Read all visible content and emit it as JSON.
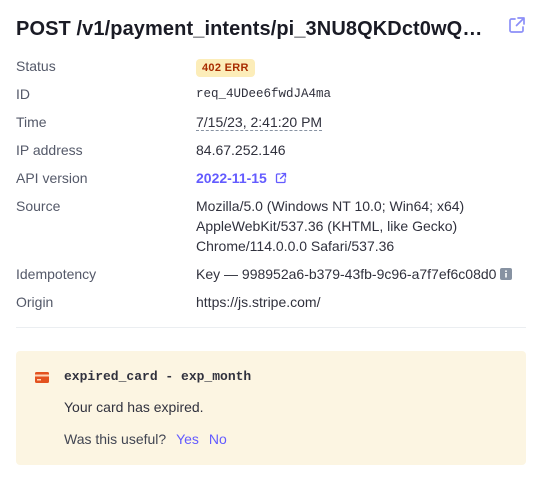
{
  "header": {
    "title": "POST /v1/payment_intents/pi_3NU8QKDct0wQ…",
    "open_icon": "external-link-icon"
  },
  "details": {
    "status": {
      "label": "Status",
      "value": "402 ERR"
    },
    "id": {
      "label": "ID",
      "value": "req_4UDee6fwdJA4ma"
    },
    "time": {
      "label": "Time",
      "value": "7/15/23, 2:41:20 PM"
    },
    "ip": {
      "label": "IP address",
      "value": "84.67.252.146"
    },
    "api_version": {
      "label": "API version",
      "value": "2022-11-15"
    },
    "source": {
      "label": "Source",
      "line1": "Mozilla/5.0 (Windows NT 10.0; Win64; x64)",
      "line2": "AppleWebKit/537.36 (KHTML, like Gecko)",
      "line3": "Chrome/114.0.0.0 Safari/537.36"
    },
    "idempotency": {
      "label": "Idempotency",
      "value": "Key — 998952a6-b379-43fb-9c96-a7f7ef6c08d0"
    },
    "origin": {
      "label": "Origin",
      "value": "https://js.stripe.com/"
    }
  },
  "alert": {
    "icon": "credit-card-icon",
    "code": "expired_card - exp_month",
    "message": "Your card has expired.",
    "feedback_question": "Was this useful?",
    "yes_label": "Yes",
    "no_label": "No"
  },
  "colors": {
    "accent": "#635bff",
    "badge_bg": "#fcedb9",
    "badge_text": "#a82c00",
    "alert_bg": "#fcf5e2"
  }
}
